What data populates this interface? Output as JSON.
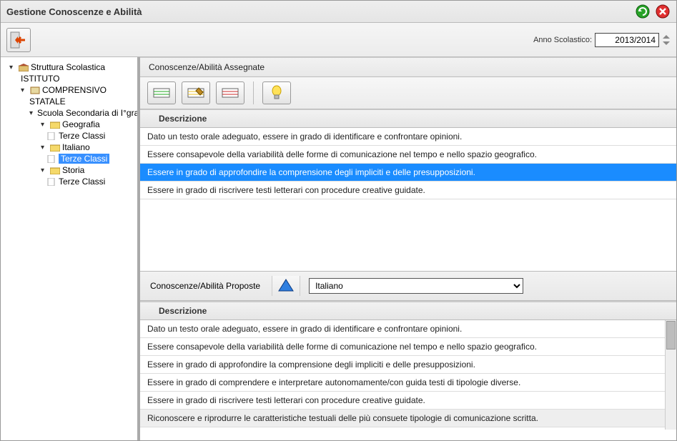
{
  "title": "Gestione Conoscenze e Abilità",
  "anno_label": "Anno Scolastico:",
  "anno_value": "2013/2014",
  "tree": {
    "root": "Struttura Scolastica",
    "ist": "ISTITUTO",
    "comp": "COMPRENSIVO",
    "stat": "STATALE",
    "scuola": "Scuola Secondaria di I°grado",
    "geografia": "Geografia",
    "terze1": "Terze Classi",
    "italiano": "Italiano",
    "terze2": "Terze Classi",
    "storia": "Storia",
    "terze3": "Terze Classi"
  },
  "assigned": {
    "title": "Conoscenze/Abilità Assegnate",
    "col_desc": "Descrizione",
    "rows": [
      "Dato un testo orale adeguato, essere in grado di identificare e confrontare opinioni.",
      "Essere consapevole della variabilità delle forme di comunicazione nel tempo e nello spazio geografico.",
      "Essere in grado di approfondire la comprensione degli impliciti e delle presupposizioni.",
      "Essere in grado di riscrivere testi letterari con procedure creative guidate."
    ],
    "selected_index": 2
  },
  "proposed": {
    "title": "Conoscenze/Abilità Proposte",
    "subject": "Italiano",
    "col_desc": "Descrizione",
    "rows": [
      "Dato un testo orale adeguato, essere in grado di identificare e confrontare opinioni.",
      "Essere consapevole della variabilità delle forme di comunicazione nel tempo e nello spazio geografico.",
      "Essere in grado di approfondire la comprensione degli impliciti e delle presupposizioni.",
      "Essere in grado di comprendere e interpretare autonomamente/con guida testi di tipologie diverse.",
      "Essere in grado di riscrivere testi letterari con procedure creative guidate.",
      "Riconoscere e riprodurre le caratteristiche testuali delle più consuete tipologie di comunicazione scritta."
    ],
    "selected_index": 5
  }
}
